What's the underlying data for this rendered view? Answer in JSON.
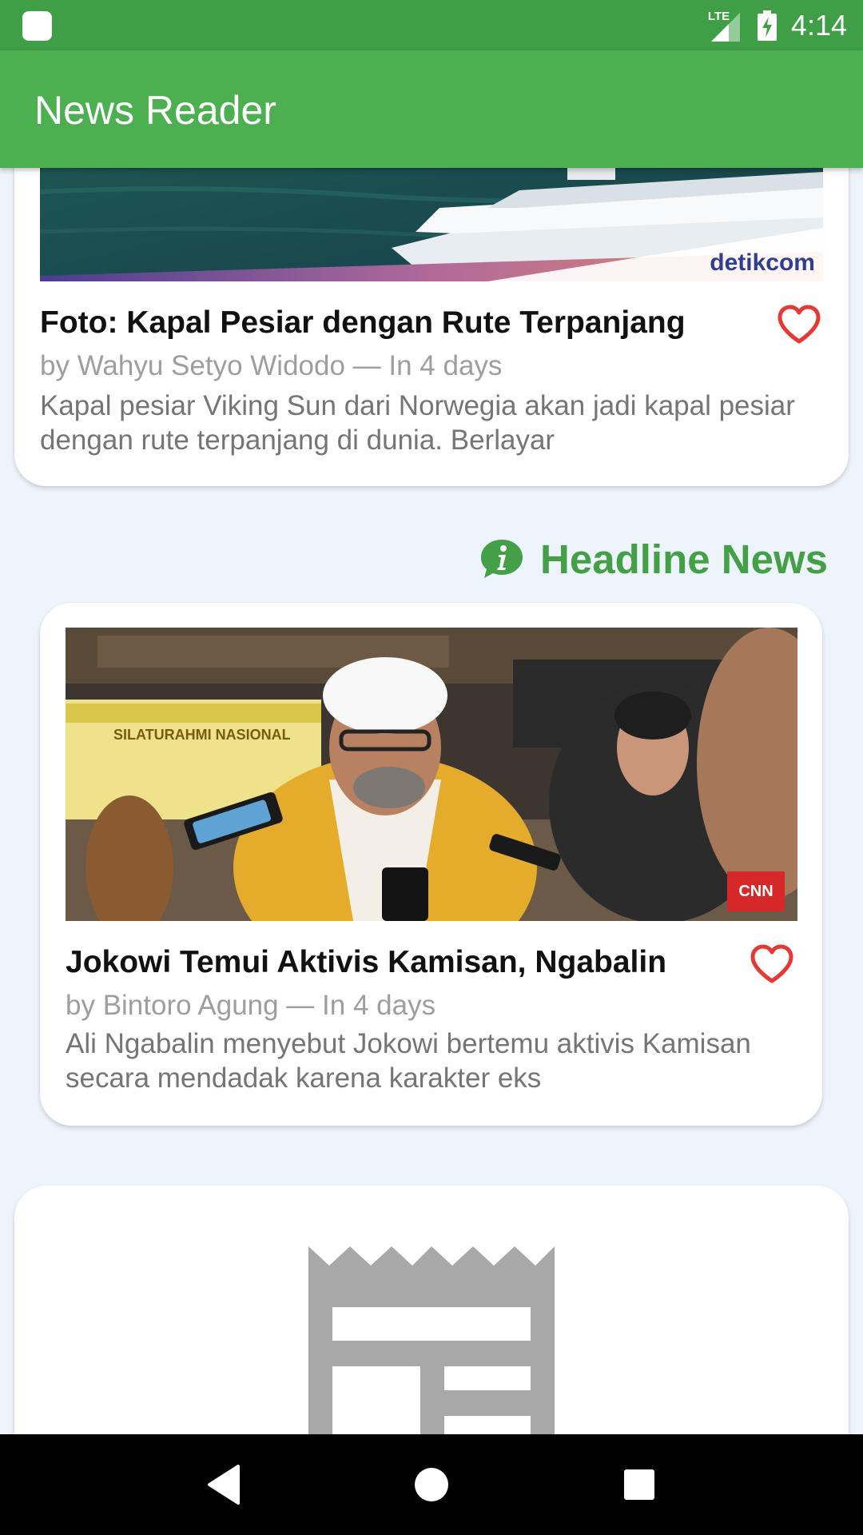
{
  "status_bar": {
    "network_label": "LTE",
    "time": "4:14",
    "icons": [
      "app-notification-icon",
      "signal-icon",
      "battery-charging-icon"
    ]
  },
  "app_bar": {
    "title": "News Reader"
  },
  "articles": [
    {
      "title": "Foto: Kapal Pesiar dengan Rute Terpanjang",
      "meta": "by Wahyu Setyo Widodo — In 4 days",
      "description": "Kapal pesiar Viking Sun dari Norwegia akan jadi kapal pesiar dengan rute terpanjang di dunia. Berlayar",
      "image_watermark": "detikcom",
      "favorite": false
    },
    {
      "title": "Jokowi Temui Aktivis Kamisan, Ngabalin",
      "meta": "by Bintoro Agung — In 4 days",
      "description": "Ali Ngabalin menyebut Jokowi bertemu aktivis Kamisan secara mendadak karena karakter eks",
      "image_watermark": "CNN",
      "image_banner": "SILATURAHMI NASIONAL",
      "favorite": false
    }
  ],
  "section": {
    "title": "Headline News",
    "icon": "info-chat-icon"
  },
  "nav_bar": {
    "buttons": [
      "back-icon",
      "home-icon",
      "recents-icon"
    ]
  },
  "colors": {
    "status_bar": "#3e9f47",
    "app_bar": "#4caf50",
    "accent_green": "#43a047",
    "heart_red": "#e53935",
    "background": "#eef4fb"
  }
}
